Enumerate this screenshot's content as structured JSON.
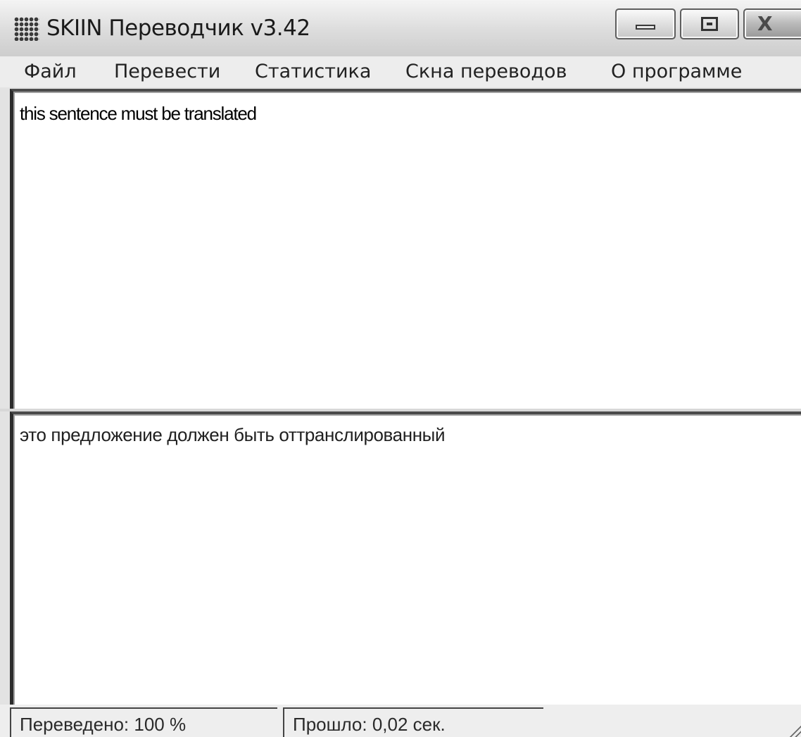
{
  "window": {
    "title": "SKIIN Переводчик v3.42",
    "icon": "dotted-grid-app-icon",
    "controls": {
      "minimize_icon": "minimize-icon",
      "maximize_icon": "maximize-icon",
      "close_glyph": "X"
    }
  },
  "menu": {
    "items": [
      "Файл",
      "Перевести",
      "Статистика",
      "Скна переводов",
      "О программе"
    ]
  },
  "source": {
    "text": "this sentence must be translated"
  },
  "target": {
    "text": "это предложение должен быть оттранслированный"
  },
  "status": {
    "translated": "Переведено: 100 %",
    "elapsed": "Прошло: 0,02 сек."
  }
}
